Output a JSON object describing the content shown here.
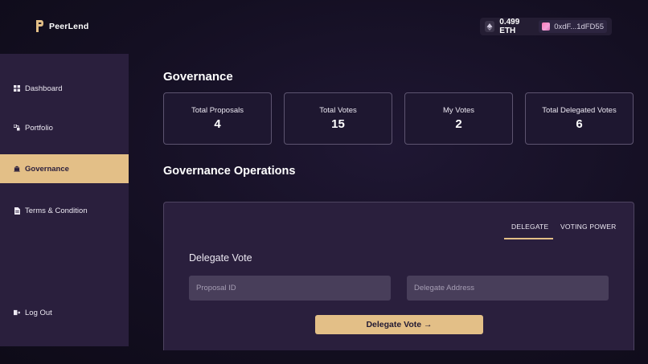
{
  "brand": {
    "name": "PeerLend",
    "logo_icon": "peerlend-logo-icon"
  },
  "wallet": {
    "balance": "0.499 ETH",
    "address": "0xdF...1dFD55",
    "eth_icon": "ethereum-icon",
    "avatar_icon": "wallet-avatar"
  },
  "sidebar": {
    "items": [
      {
        "label": "Dashboard",
        "icon": "grid-icon"
      },
      {
        "label": "Portfolio",
        "icon": "portfolio-icon"
      },
      {
        "label": "Governance",
        "icon": "bank-icon",
        "active": true
      },
      {
        "label": "Terms & Condition",
        "icon": "document-icon"
      }
    ],
    "logout": {
      "label": "Log Out",
      "icon": "logout-icon"
    }
  },
  "main": {
    "title": "Governance",
    "stats": [
      {
        "label": "Total Proposals",
        "value": "4"
      },
      {
        "label": "Total Votes",
        "value": "15"
      },
      {
        "label": "My Votes",
        "value": "2"
      },
      {
        "label": "Total Delegated Votes",
        "value": "6"
      }
    ],
    "operations_title": "Governance Operations",
    "tabs": [
      {
        "label": "DELEGATE",
        "active": true
      },
      {
        "label": "VOTING POWER",
        "active": false
      }
    ],
    "form": {
      "title": "Delegate Vote",
      "proposal_placeholder": "Proposal ID",
      "delegate_placeholder": "Delegate Address",
      "submit_label": "Delegate Vote →"
    }
  },
  "colors": {
    "accent": "#e3bf87",
    "sidebar_bg": "#2a1f3d",
    "page_bg": "#140f22"
  }
}
